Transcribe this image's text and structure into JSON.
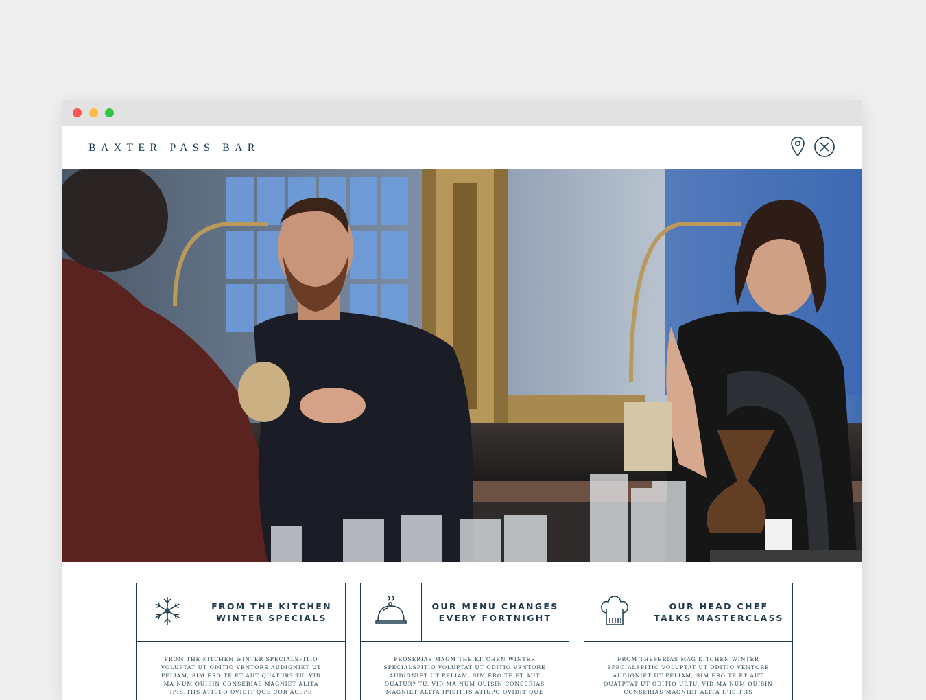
{
  "site": {
    "brand": "BAXTER PASS BAR",
    "header_icons": {
      "location": "map-pin-icon",
      "close": "close-circle-icon"
    }
  },
  "hero": {
    "description": "bar-staff-photo"
  },
  "cards": [
    {
      "icon": "snowflake-icon",
      "title_line1": "FROM THE KITCHEN",
      "title_line2": "WINTER SPECIALS",
      "body": "FROM THE KITCHEN WINTER SPECIALSPITIO VOLUPTAT UT ODITIO VENTORE AUDIGNIET UT PELIAM, SIM ERO TE ET AUT QUATUR? TU, VID MA NUM QUISIN CONSERIAS MAGNIET ALITA IPISITIIS ATIUPO OVIDIT QUE COR ACEPE"
    },
    {
      "icon": "cloche-icon",
      "title_line1": "OUR MENU CHANGES",
      "title_line2": "EVERY FORTNIGHT",
      "body": "FROSERIAS MAGM THE KITCHEN WINTER SPECIALSPITIO VOLUPTAT UT ODITIO VENTORE AUDIGNIET UT PELIAM, SIM ERO TE ET AUT QUATUR? TU, VID MA NUM QUISIN CONSERIAS MAGNIET ALITA IPISITIIS ATIUPO OVIDIT QUE"
    },
    {
      "icon": "chef-hat-icon",
      "title_line1": "OUR HEAD CHEF",
      "title_line2": "TALKS MASTERCLASS",
      "body": "FROM THESERIAS MAG KITCHEN WINTER SPECIALSPITIO VOLUPTAT UT ODITIO VENTORE AUDIGNIET UT PELIAM, SIM ERO TE ET AUT QUATPTAT UT ODITIO URTU, VID MA NUM QUISIN CONSERIAS MAGNIET ALITA IPISITIIS"
    }
  ],
  "colors": {
    "ink": "#1d3a4c",
    "brand": "#163a52",
    "page_bg": "#efefef",
    "titlebar": "#e2e2e2"
  }
}
